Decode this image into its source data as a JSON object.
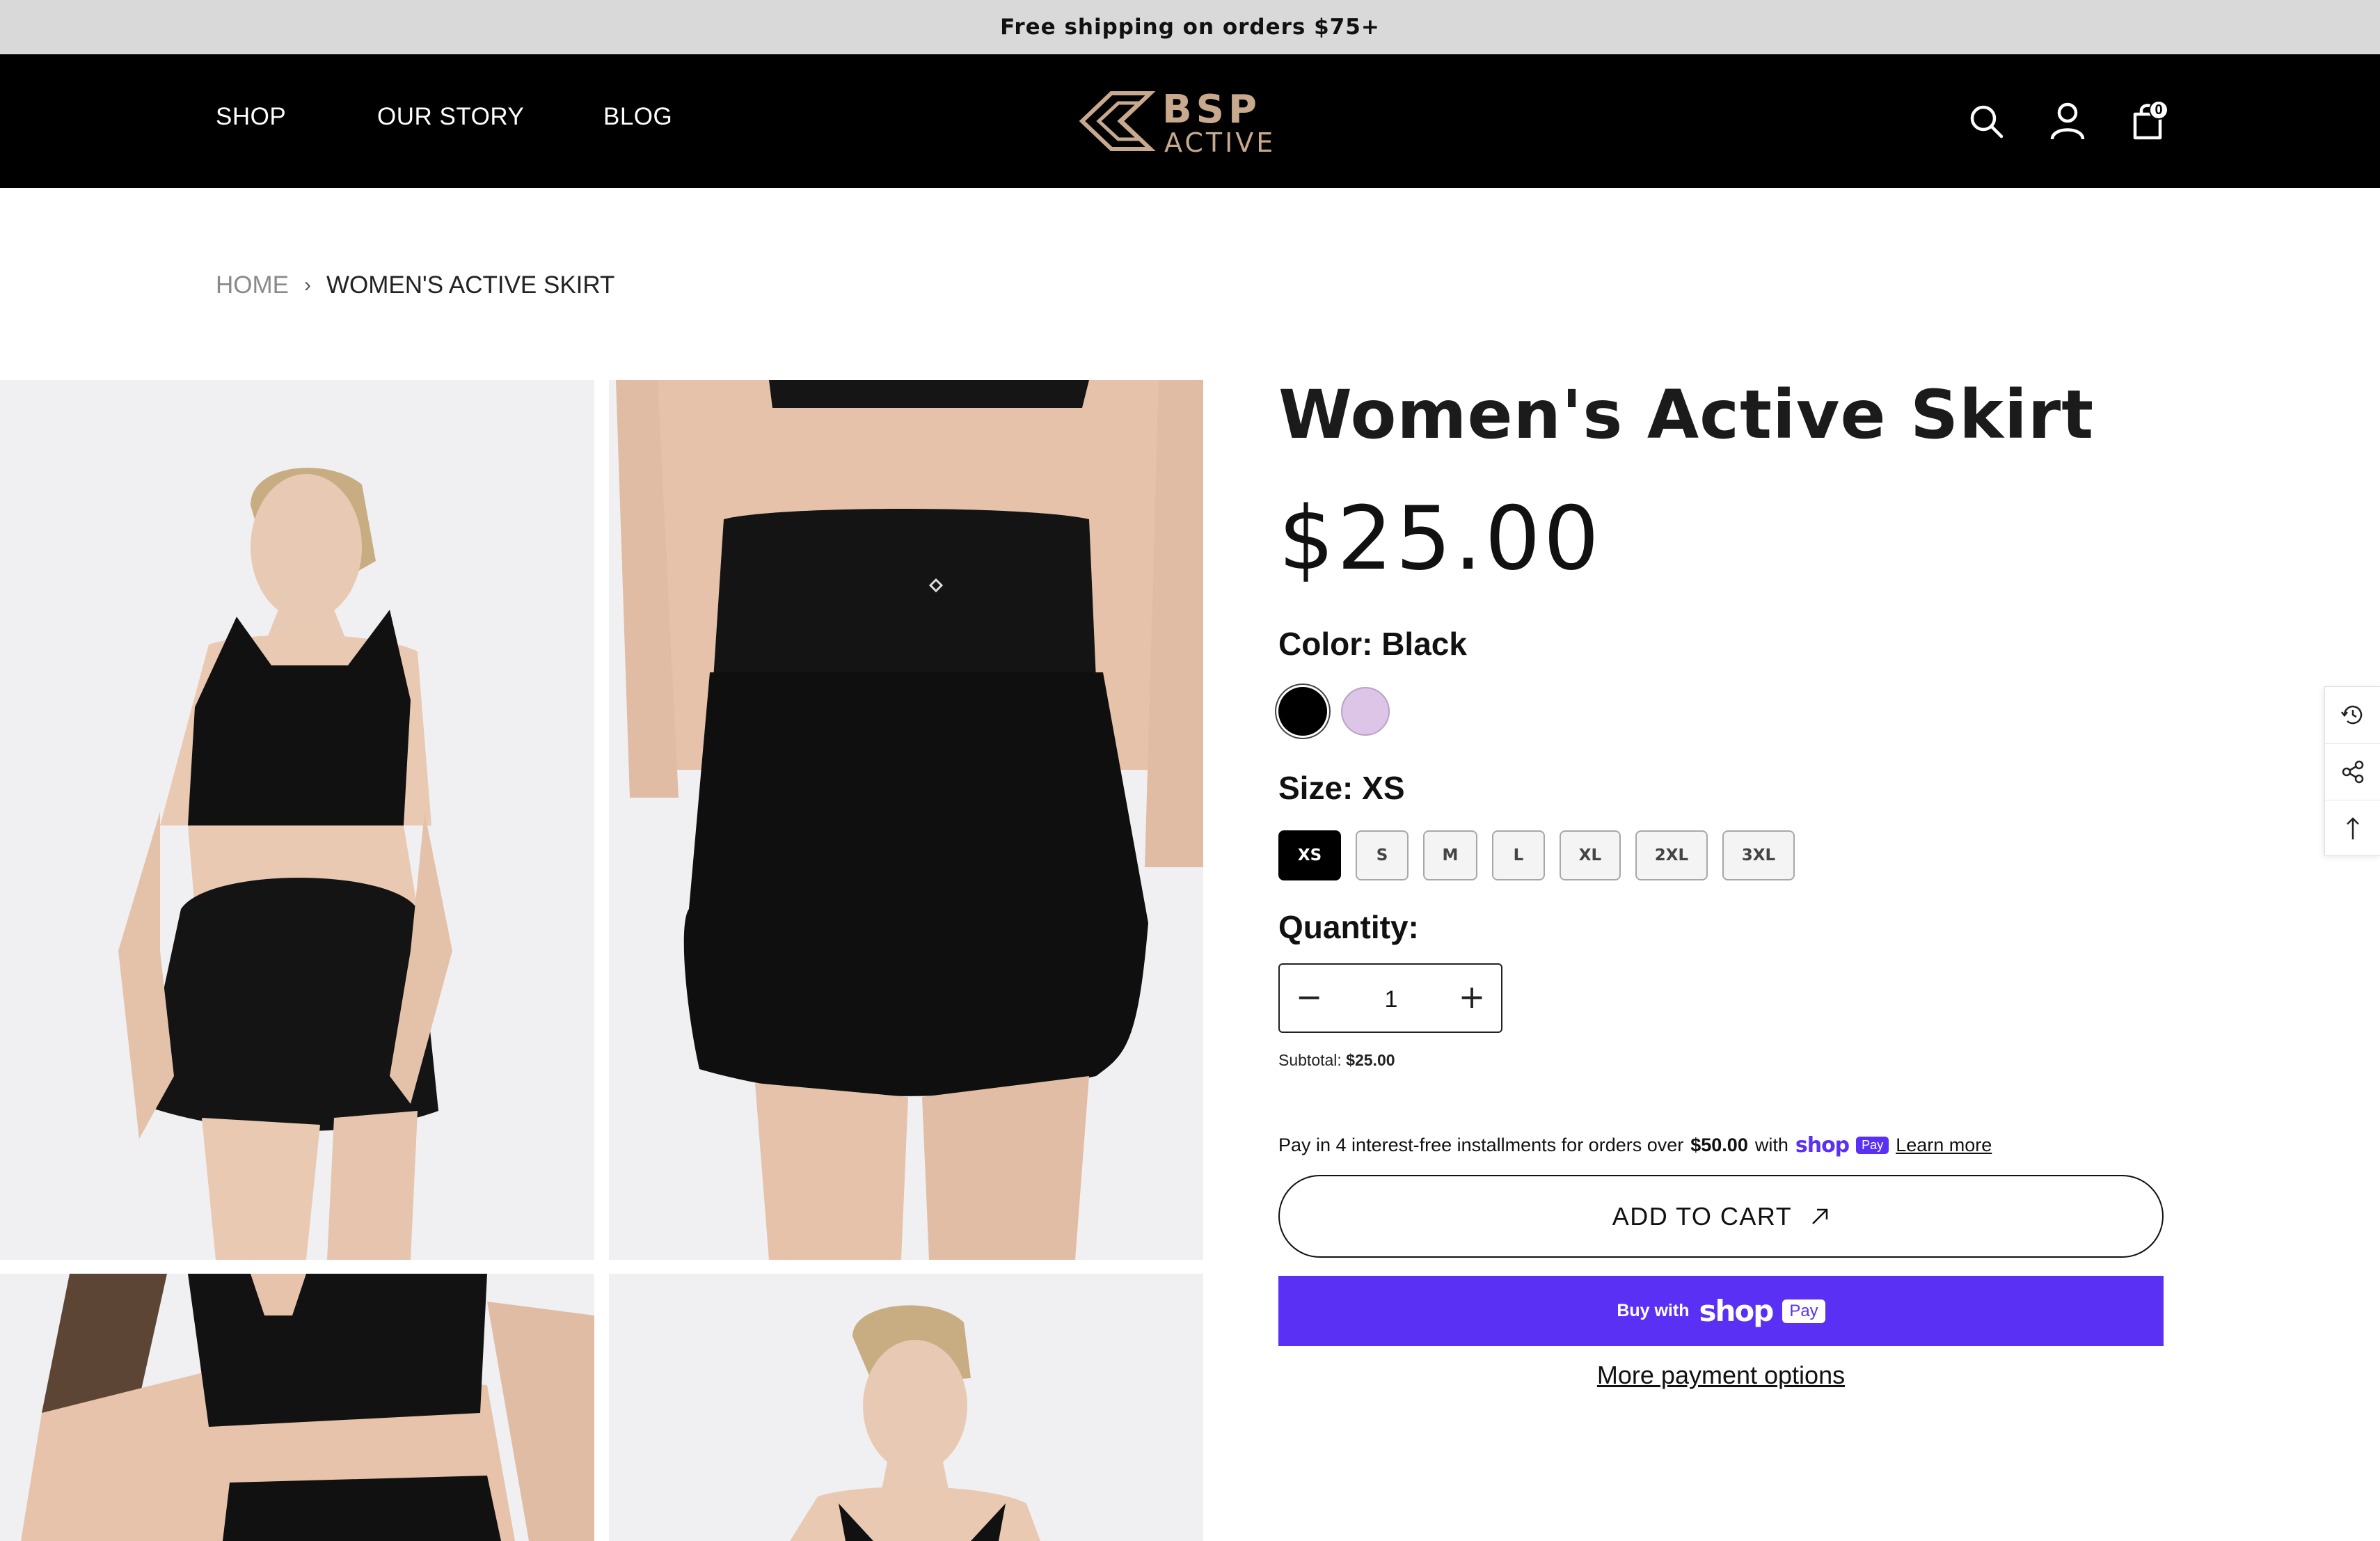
{
  "announcement": "Free shipping on orders $75+",
  "nav": {
    "links": [
      "SHOP",
      "OUR STORY",
      "BLOG"
    ],
    "logo_text": [
      "BSP",
      "ACTIVE"
    ],
    "icons": [
      "search-icon",
      "account-icon",
      "cart-icon"
    ],
    "cart_count": "0"
  },
  "breadcrumb": {
    "home": "HOME",
    "current": "WOMEN'S ACTIVE SKIRT"
  },
  "product": {
    "title": "Women's Active Skirt",
    "price": "$25.00",
    "color_label": "Color: Black",
    "colors": [
      {
        "name": "Black",
        "hex": "#000000",
        "selected": true
      },
      {
        "name": "Lavender",
        "hex": "#dcc5e6",
        "selected": false
      }
    ],
    "size_label": "Size: XS",
    "sizes": [
      "XS",
      "S",
      "M",
      "L",
      "XL",
      "2XL",
      "3XL"
    ],
    "selected_size": "XS",
    "quantity_label": "Quantity:",
    "quantity": "1",
    "qty_minus": "−",
    "qty_plus": "+",
    "subtotal_label": "Subtotal:",
    "subtotal_value": "$25.00"
  },
  "installments": {
    "text": "Pay in 4 interest-free installments for orders over",
    "amount": "$50.00",
    "with": "with",
    "shop": "shop",
    "pay": "Pay",
    "learn_more": "Learn more"
  },
  "buttons": {
    "add_to_cart": "ADD TO CART",
    "buy_with": "Buy with",
    "shop": "shop",
    "pay": "Pay",
    "more_payment": "More payment options"
  },
  "side_tools": [
    "recently-viewed-icon",
    "share-icon",
    "back-to-top-icon"
  ],
  "colors": {
    "header_bg": "#000000",
    "announcement_bg": "#d9d9d9",
    "shop_pay": "#5a31f4",
    "logo_gold": "#c8a98e"
  }
}
